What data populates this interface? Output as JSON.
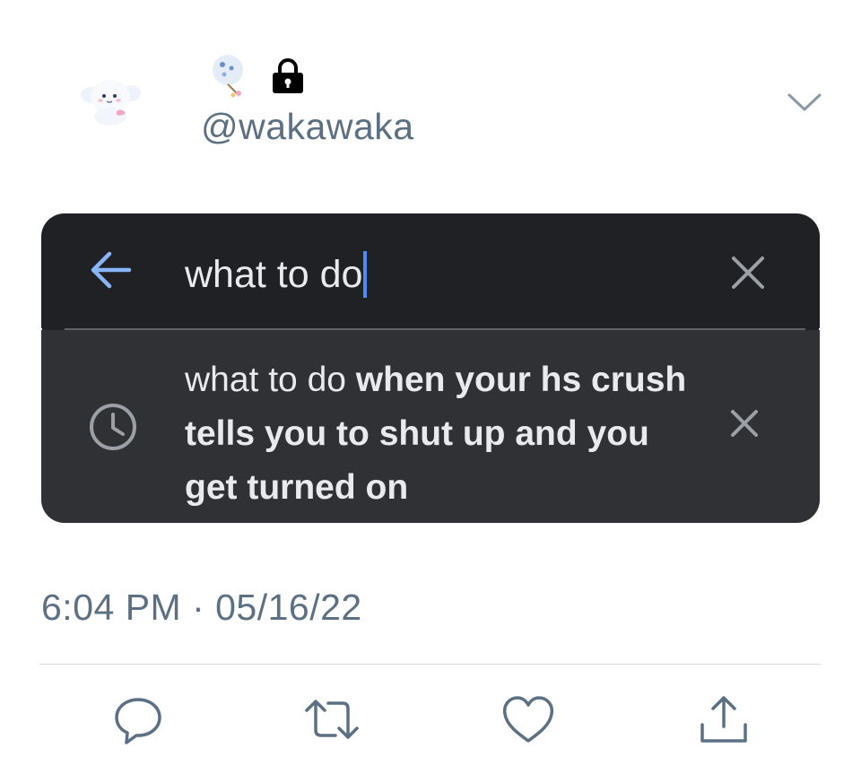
{
  "tweet": {
    "handle": "@wakawaka",
    "avatar_icon": "cinnamoroll-plush-avatar",
    "name_icons": [
      "fan-emoji-icon",
      "lock-icon"
    ],
    "timestamp": "6:04 PM · 05/16/22"
  },
  "search_card": {
    "query_text": "what to do",
    "suggestion": {
      "prefix": "what to do ",
      "completion": "when your hs crush tells you to shut up and you get turned on"
    },
    "colors": {
      "bar_bg": "#202124",
      "suggestion_bg": "#303134",
      "text": "#e8eaed",
      "accent": "#4a8cf7"
    }
  },
  "actions": [
    "reply-icon",
    "retweet-icon",
    "like-icon",
    "share-icon"
  ]
}
